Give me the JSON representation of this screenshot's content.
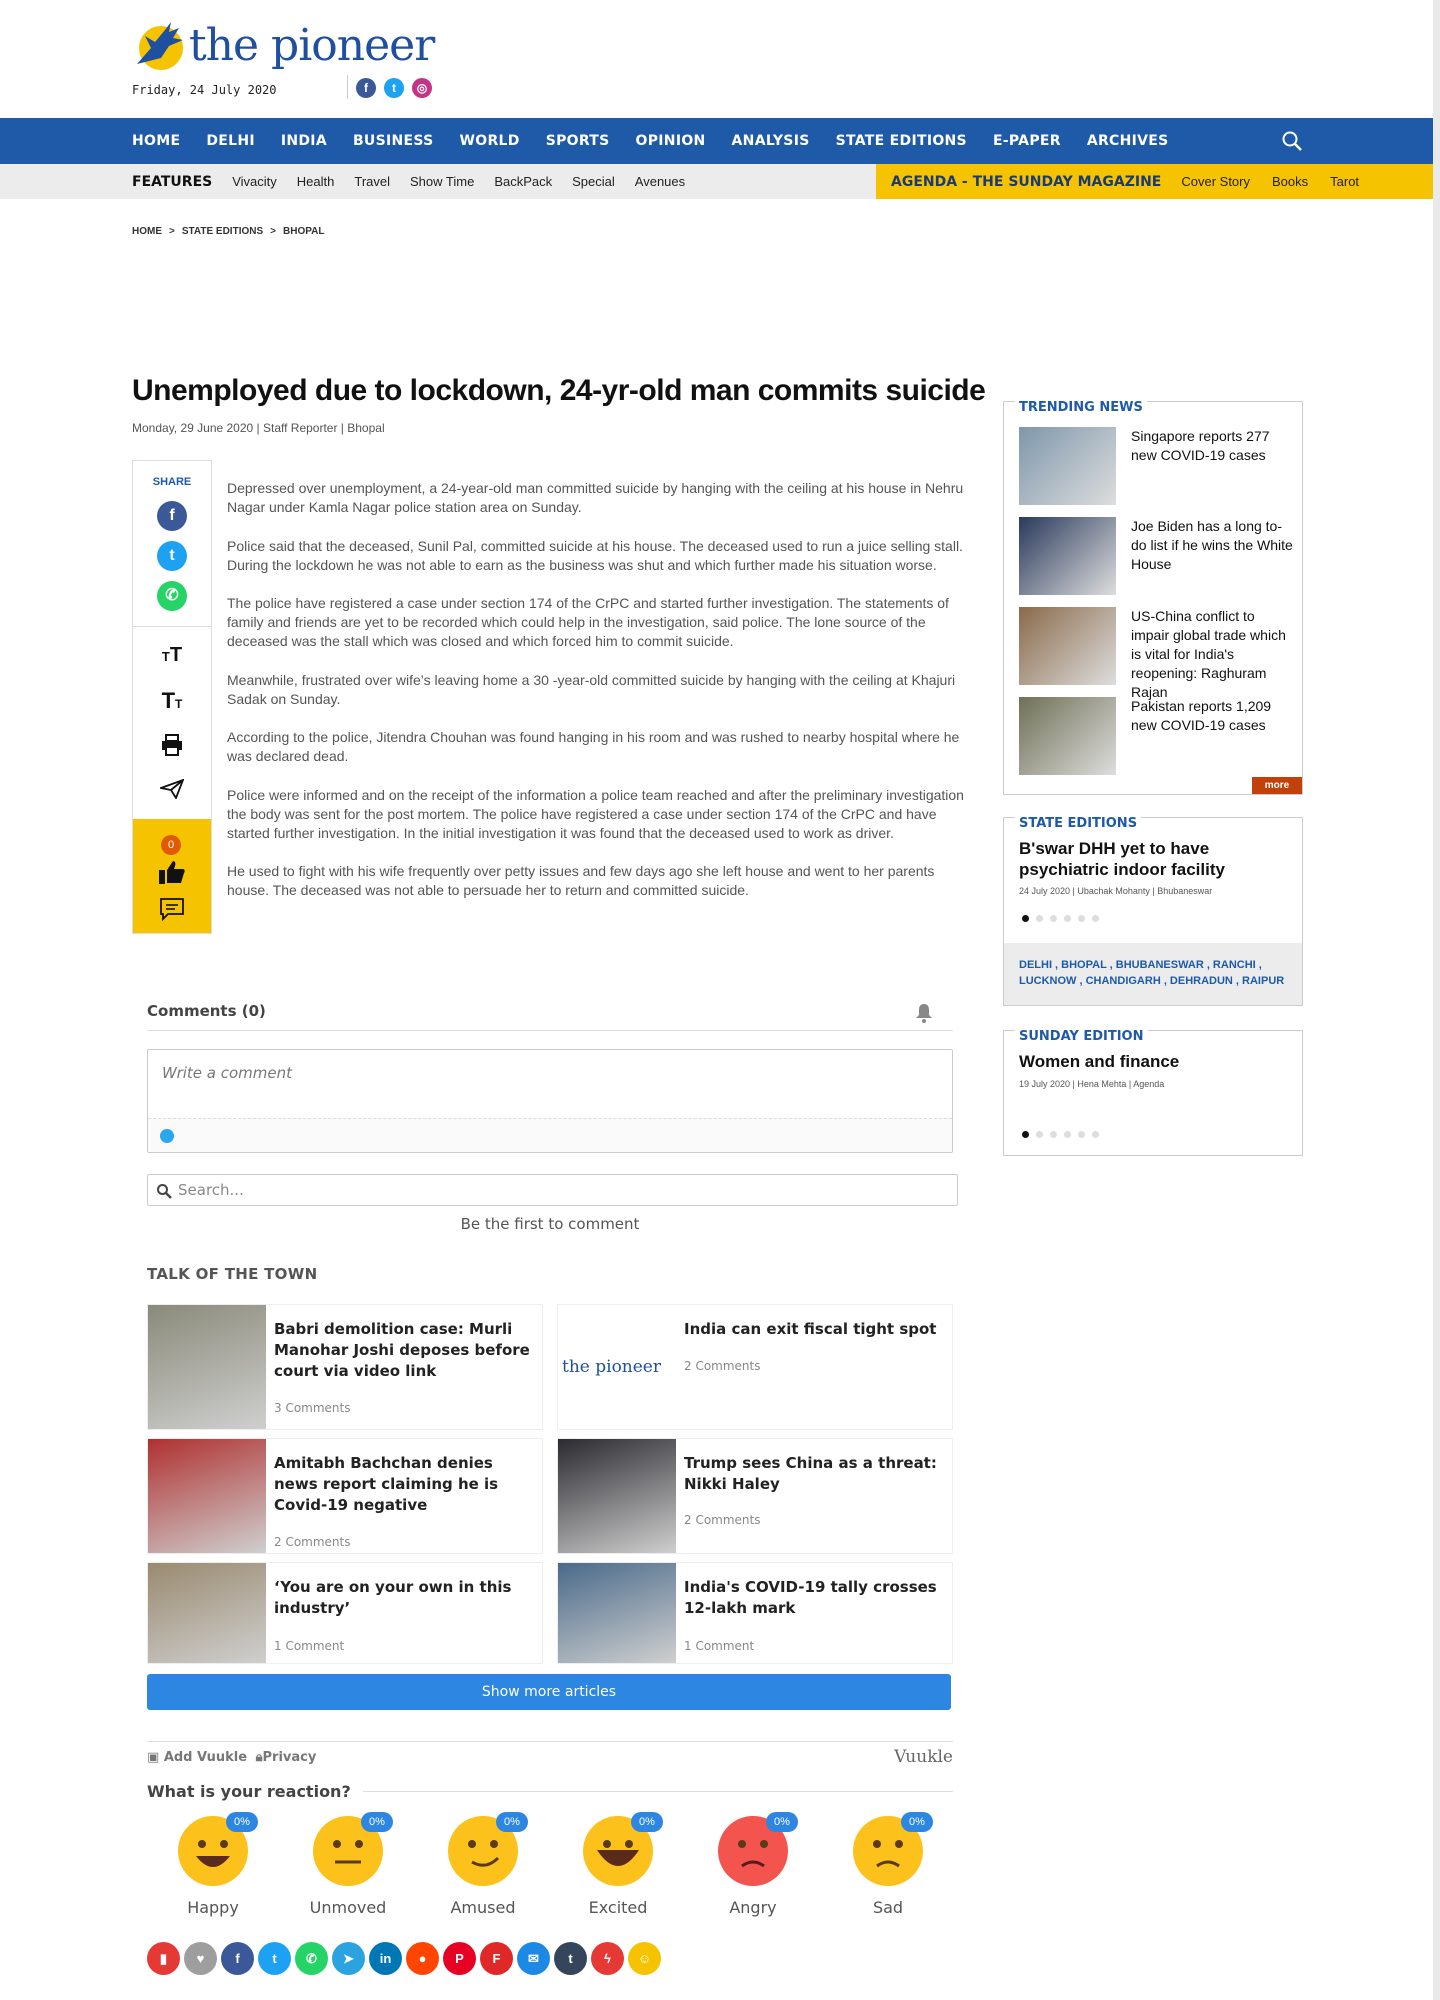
{
  "header": {
    "logo_text": "the pioneer",
    "date": "Friday, 24 July 2020",
    "social": [
      {
        "name": "facebook-icon",
        "glyph": "f",
        "color": "#3b5998"
      },
      {
        "name": "twitter-icon",
        "glyph": "t",
        "color": "#1da1f2"
      },
      {
        "name": "instagram-icon",
        "glyph": "◎",
        "color": "#c13584"
      }
    ]
  },
  "mainnav": {
    "items": [
      "HOME",
      "DELHI",
      "INDIA",
      "BUSINESS",
      "WORLD",
      "SPORTS",
      "OPINION",
      "ANALYSIS",
      "STATE EDITIONS",
      "E-PAPER",
      "ARCHIVES"
    ],
    "search_icon": "search-icon"
  },
  "subnav": {
    "features_label": "FEATURES",
    "features": [
      "Vivacity",
      "Health",
      "Travel",
      "Show Time",
      "BackPack",
      "Special",
      "Avenues"
    ],
    "agenda_label": "AGENDA - THE SUNDAY MAGAZINE",
    "agenda": [
      "Cover Story",
      "Books",
      "Tarot"
    ]
  },
  "breadcrumb": [
    "HOME",
    "STATE EDITIONS",
    "BHOPAL"
  ],
  "article": {
    "title": "Unemployed due to lockdown, 24-yr-old man commits suicide",
    "meta": "Monday, 29 June 2020 | Staff Reporter | Bhopal",
    "share_label": "SHARE",
    "like_count": "0",
    "paragraphs": [
      "Depressed over unemployment, a 24-year-old man committed suicide by hanging with the ceiling at his house in Nehru Nagar under Kamla Nagar police station area on Sunday.",
      "Police said that the deceased, Sunil Pal, committed suicide at his house. The deceased used to run a juice selling stall. During the lockdown he was not able to earn as the business was shut and which further made his situation worse.",
      "The police have registered a case under section 174 of the CrPC and started further investigation. The statements of family and friends are yet to be recorded which could help in the investigation, said police. The lone source of the deceased was the stall which was closed and which forced him to commit suicide.",
      "Meanwhile, frustrated over wife’s leaving home a 30 -year-old committed suicide by hanging with the ceiling at Khajuri Sadak  on Sunday.",
      "According to the police, Jitendra Chouhan was found hanging in his room and was rushed to nearby hospital where he was declared dead.",
      "Police were informed and on the receipt of the information a police team reached and after the preliminary investigation the body was sent for the post mortem. The police have registered a case under section 174 of the CrPC and have started further investigation. In the initial investigation it was found that the deceased used to work as driver.",
      "He used to fight with his wife frequently over petty issues and few days ago she left house and went to her parents house. The deceased was not able to persuade her to return and committed suicide."
    ]
  },
  "sidebar": {
    "trending": {
      "title": "TRENDING NEWS",
      "more": "more",
      "items": [
        {
          "text": "Singapore reports 277 new COVID-19 cases",
          "color": "#7e97ab"
        },
        {
          "text": "Joe Biden has a long to-do list if he wins the White House",
          "color": "#2a3a5c"
        },
        {
          "text": "US-China conflict to impair global trade which is vital for India's reopening: Raghuram Rajan",
          "color": "#8a6a4a"
        },
        {
          "text": "Pakistan reports 1,209 new COVID-19 cases",
          "color": "#6f7055"
        }
      ]
    },
    "state": {
      "title": "STATE EDITIONS",
      "headline": "B'swar DHH yet to have psychiatric indoor facility",
      "meta": "24 July 2020 | Ubachak Mohanty | Bhubaneswar",
      "links_line1": "DELHI , BHOPAL , BHUBANESWAR , RANCHI ,",
      "links_line2": "LUCKNOW , CHANDIGARH , DEHRADUN , RAIPUR"
    },
    "sunday": {
      "title": "SUNDAY EDITION",
      "headline": "Women and finance",
      "meta": "19 July 2020 | Hena Mehta | Agenda"
    }
  },
  "comments": {
    "title": "Comments (0)",
    "placeholder": "Write a comment",
    "search_placeholder": "Search...",
    "empty": "Be the first to comment"
  },
  "talk": {
    "title": "TALK OF THE TOWN",
    "cards": [
      {
        "title": "Babri demolition case: Murli Manohar Joshi deposes before court via video link",
        "comments": "3 Comments",
        "color": "#8a8a7a"
      },
      {
        "title": "India can exit fiscal tight spot",
        "comments": "2 Comments",
        "color": "#ffffff",
        "logo": "the pioneer"
      },
      {
        "title": "Amitabh Bachchan denies news report claiming he is Covid-19 negative",
        "comments": "2 Comments",
        "color": "#b03030"
      },
      {
        "title": "Trump sees China as a threat: Nikki Haley",
        "comments": "2 Comments",
        "color": "#2a2a30"
      },
      {
        "title": "‘You are on your own in this industry’",
        "comments": "1 Comment",
        "color": "#9a8a70"
      },
      {
        "title": "India's COVID-19 tally crosses 12-lakh mark",
        "comments": "1 Comment",
        "color": "#4a6a8a"
      }
    ],
    "show_more": "Show more articles"
  },
  "vuukle": {
    "add": "Add Vuukle",
    "privacy": "Privacy",
    "brand": "Vuukle",
    "reaction_title": "What is your reaction?",
    "reactions": [
      {
        "label": "Happy",
        "pct": "0%"
      },
      {
        "label": "Unmoved",
        "pct": "0%"
      },
      {
        "label": "Amused",
        "pct": "0%"
      },
      {
        "label": "Excited",
        "pct": "0%"
      },
      {
        "label": "Angry",
        "pct": "0%"
      },
      {
        "label": "Sad",
        "pct": "0%"
      }
    ],
    "share_icons": [
      {
        "name": "comment-icon",
        "color": "#e53935"
      },
      {
        "name": "heart-icon",
        "color": "#9e9e9e"
      },
      {
        "name": "facebook-icon",
        "color": "#3b5998"
      },
      {
        "name": "twitter-icon",
        "color": "#1da1f2"
      },
      {
        "name": "whatsapp-icon",
        "color": "#25d366"
      },
      {
        "name": "telegram-icon",
        "color": "#2aa3e0"
      },
      {
        "name": "linkedin-icon",
        "color": "#0077b5"
      },
      {
        "name": "reddit-icon",
        "color": "#ff4500"
      },
      {
        "name": "pinterest-icon",
        "color": "#e60023"
      },
      {
        "name": "flipboard-icon",
        "color": "#e12828"
      },
      {
        "name": "email-icon",
        "color": "#1e88e5"
      },
      {
        "name": "tumblr-icon",
        "color": "#35465c"
      },
      {
        "name": "messenger-icon",
        "color": "#e53935"
      },
      {
        "name": "emoji-icon",
        "color": "#f6c300"
      }
    ]
  }
}
